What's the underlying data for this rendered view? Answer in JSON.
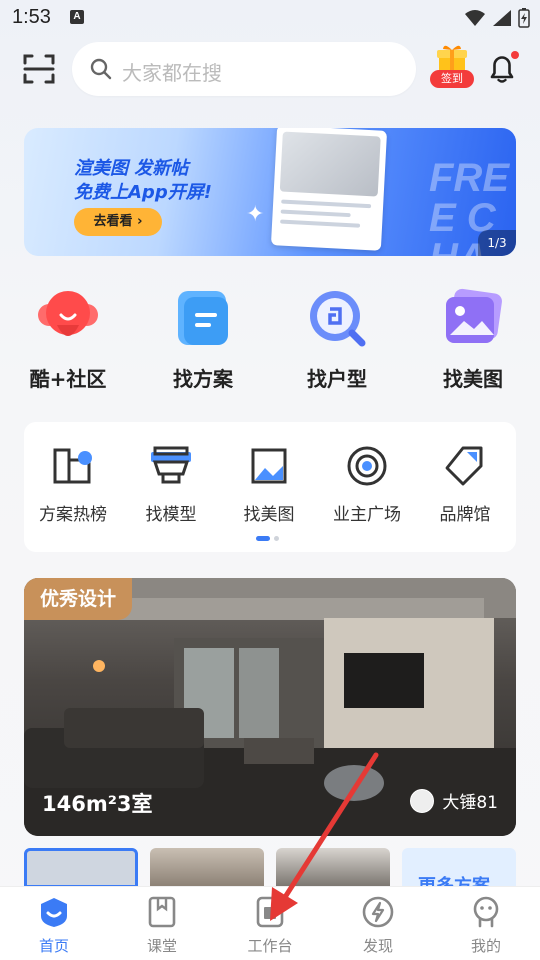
{
  "status": {
    "time": "1:53",
    "notif_letter": "A"
  },
  "header": {
    "search_placeholder": "大家都在搜",
    "checkin_label": "签到"
  },
  "banner": {
    "line1": "渲美图 发新帖",
    "line2": "免费上App开屏!",
    "button": "去看看 ›",
    "watermark": "FREE CHA",
    "page": "1/3"
  },
  "big_icons": [
    {
      "label": "酷+社区",
      "icon": "community-icon"
    },
    {
      "label": "找方案",
      "icon": "plan-icon"
    },
    {
      "label": "找户型",
      "icon": "floorplan-icon"
    },
    {
      "label": "找美图",
      "icon": "gallery-icon"
    }
  ],
  "small_icons": [
    {
      "label": "方案热榜",
      "icon": "ranking-icon"
    },
    {
      "label": "找模型",
      "icon": "model-icon"
    },
    {
      "label": "找美图",
      "icon": "image-icon"
    },
    {
      "label": "业主广场",
      "icon": "owner-plaza-icon"
    },
    {
      "label": "品牌馆",
      "icon": "brand-icon"
    }
  ],
  "feature": {
    "tag": "优秀设计",
    "title": "146m²3室",
    "author": "大锤81"
  },
  "thumbs": {
    "more": "更多方案"
  },
  "nav": [
    {
      "label": "首页",
      "active": true
    },
    {
      "label": "课堂",
      "active": false
    },
    {
      "label": "工作台",
      "active": false
    },
    {
      "label": "发现",
      "active": false
    },
    {
      "label": "我的",
      "active": false
    }
  ],
  "colors": {
    "accent": "#3b7bf5",
    "tag": "#c8915a",
    "banner_button": "#ffb436",
    "arrow": "#e53935"
  }
}
